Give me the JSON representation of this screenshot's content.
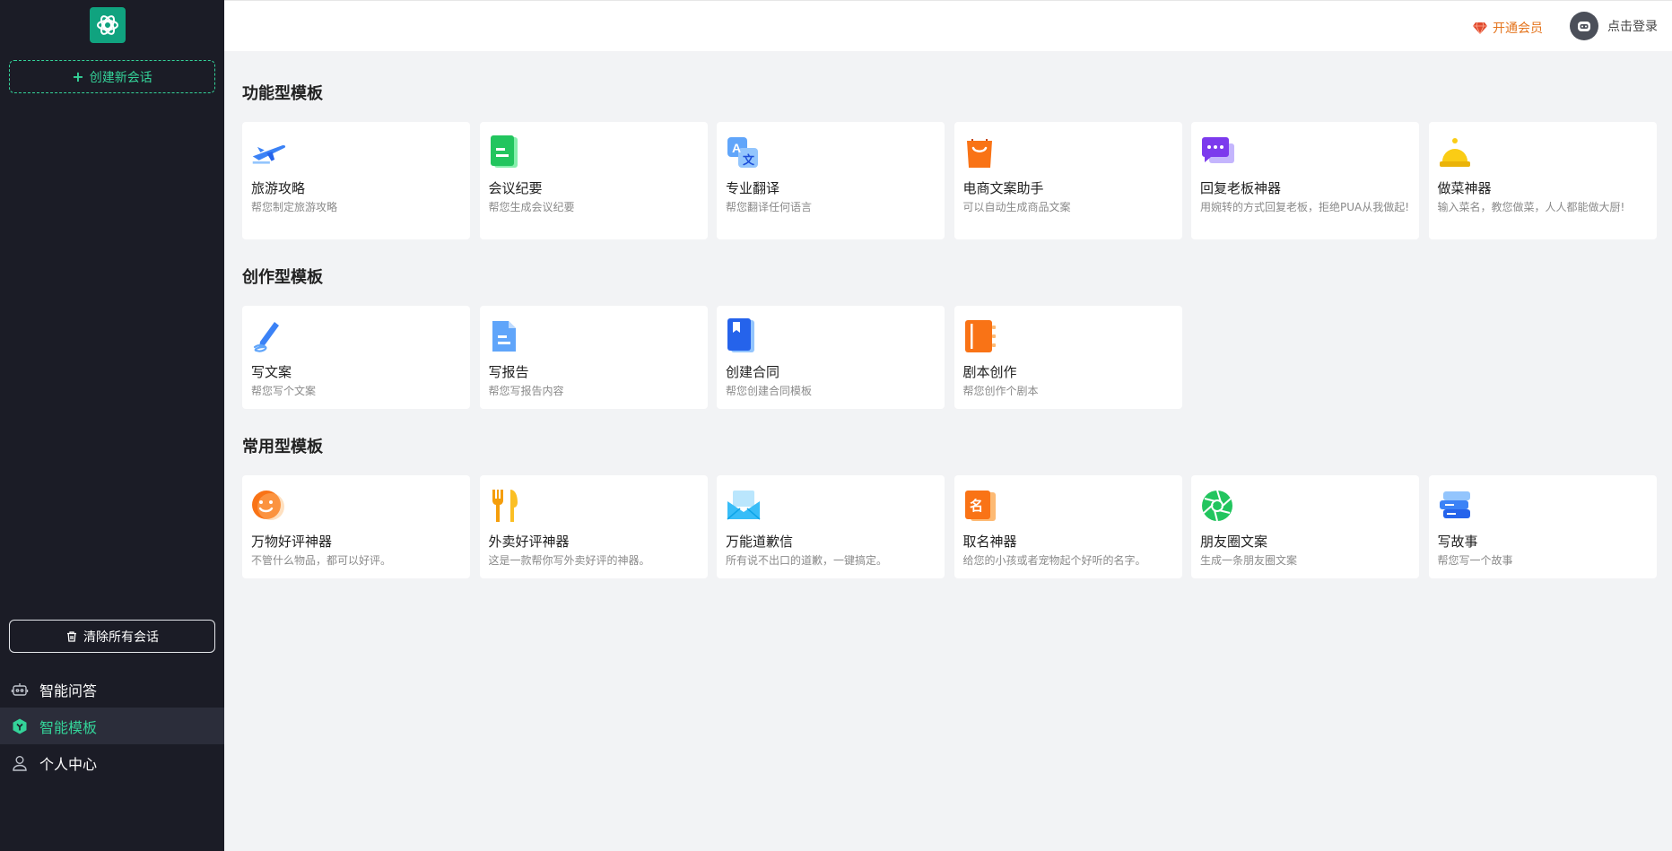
{
  "sidebar": {
    "new_chat_label": "创建新会话",
    "clear_all_label": "清除所有会话",
    "nav": [
      {
        "label": "智能问答",
        "icon": "robot-icon"
      },
      {
        "label": "智能模板",
        "icon": "template-icon",
        "active": true
      },
      {
        "label": "个人中心",
        "icon": "user-icon"
      }
    ]
  },
  "header": {
    "vip_label": "开通会员",
    "login_label": "点击登录"
  },
  "sections": [
    {
      "title": "功能型模板",
      "cards": [
        {
          "title": "旅游攻略",
          "desc": "帮您制定旅游攻略",
          "icon": "airplane-icon"
        },
        {
          "title": "会议纪要",
          "desc": "帮您生成会议纪要",
          "icon": "document-icon"
        },
        {
          "title": "专业翻译",
          "desc": "帮您翻译任何语言",
          "icon": "translate-icon"
        },
        {
          "title": "电商文案助手",
          "desc": "可以自动生成商品文案",
          "icon": "shopping-bag-icon"
        },
        {
          "title": "回复老板神器",
          "desc": "用婉转的方式回复老板，拒绝PUA从我做起!",
          "icon": "chat-bubble-icon"
        },
        {
          "title": "做菜神器",
          "desc": "输入菜名，教您做菜，人人都能做大厨!",
          "icon": "cloche-icon"
        }
      ]
    },
    {
      "title": "创作型模板",
      "cards": [
        {
          "title": "写文案",
          "desc": "帮您写个文案",
          "icon": "pen-icon"
        },
        {
          "title": "写报告",
          "desc": "帮您写报告内容",
          "icon": "report-icon"
        },
        {
          "title": "创建合同",
          "desc": "帮您创建合同模板",
          "icon": "contract-book-icon"
        },
        {
          "title": "剧本创作",
          "desc": "帮您创作个剧本",
          "icon": "notebook-icon"
        }
      ]
    },
    {
      "title": "常用型模板",
      "cards": [
        {
          "title": "万物好评神器",
          "desc": "不管什么物品，都可以好评。",
          "icon": "smiley-icon"
        },
        {
          "title": "外卖好评神器",
          "desc": "这是一款帮你写外卖好评的神器。",
          "icon": "fork-knife-icon"
        },
        {
          "title": "万能道歉信",
          "desc": "所有说不出口的道歉，一键搞定。",
          "icon": "envelope-icon"
        },
        {
          "title": "取名神器",
          "desc": "给您的小孩或者宠物起个好听的名字。",
          "icon": "name-tag-icon"
        },
        {
          "title": "朋友圈文案",
          "desc": "生成一条朋友圈文案",
          "icon": "aperture-icon"
        },
        {
          "title": "写故事",
          "desc": "帮您写一个故事",
          "icon": "books-icon"
        }
      ]
    }
  ],
  "colors": {
    "sidebar_bg": "#1b1c26",
    "accent_green": "#34d399",
    "vip_orange": "#e4741d",
    "page_bg": "#f2f3f5"
  }
}
